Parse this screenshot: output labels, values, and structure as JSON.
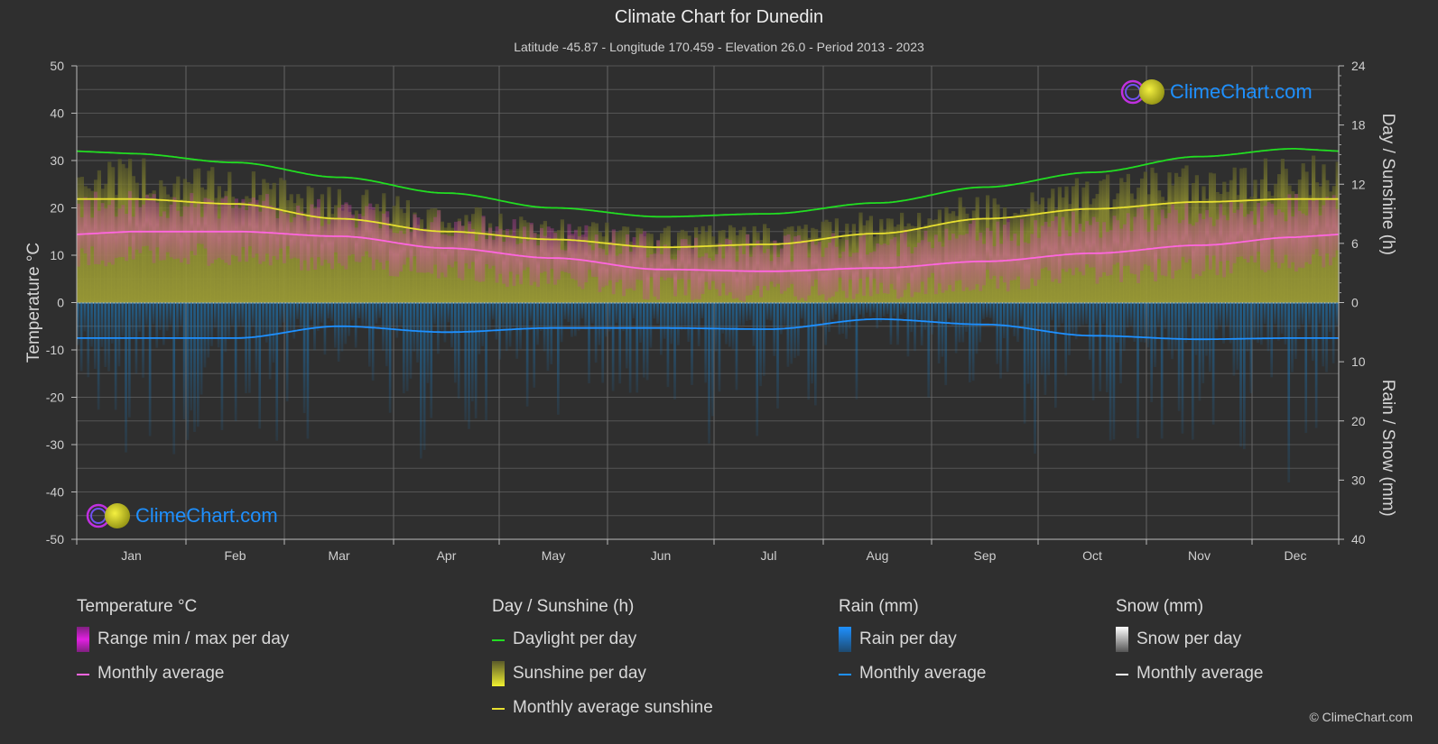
{
  "header": {
    "title": "Climate Chart for Dunedin",
    "subtitle": "Latitude -45.87 - Longitude 170.459 - Elevation 26.0 - Period 2013 - 2023"
  },
  "logo": {
    "text": "ClimeChart.com"
  },
  "copyright": "© ClimeChart.com",
  "colors": {
    "background": "#2f2f2f",
    "grid": "#5a5a5a",
    "temp_range": "#d040c0",
    "temp_avg": "#ff66e0",
    "daylight": "#22dd22",
    "sunshine_bar": "#9a9a30",
    "sunshine_avg": "#e8e030",
    "rain_bar": "#1e6ea8",
    "rain_avg": "#1e90ff",
    "snow_avg": "#ffffff",
    "logo_blue": "#1e90ff"
  },
  "legend": {
    "groups": [
      {
        "title": "Temperature °C",
        "items": [
          {
            "label": "Range min / max per day",
            "kind": "bar",
            "color": "#e020e0"
          },
          {
            "label": "Monthly average",
            "kind": "line",
            "color": "#ff66e0"
          }
        ]
      },
      {
        "title": "Day / Sunshine (h)",
        "items": [
          {
            "label": "Daylight per day",
            "kind": "line",
            "color": "#22dd22"
          },
          {
            "label": "Sunshine per day",
            "kind": "bar",
            "color": "#e8e030"
          },
          {
            "label": "Monthly average sunshine",
            "kind": "line",
            "color": "#e8e030"
          }
        ]
      },
      {
        "title": "Rain (mm)",
        "items": [
          {
            "label": "Rain per day",
            "kind": "bar",
            "color": "#1e90ff"
          },
          {
            "label": "Monthly average",
            "kind": "line",
            "color": "#1e90ff"
          }
        ]
      },
      {
        "title": "Snow (mm)",
        "items": [
          {
            "label": "Snow per day",
            "kind": "bar",
            "color": "#ffffff"
          },
          {
            "label": "Monthly average",
            "kind": "line",
            "color": "#ffffff"
          }
        ]
      }
    ]
  },
  "chart_data": {
    "type": "line",
    "title": "Climate Chart for Dunedin",
    "subtitle": "Latitude -45.87 - Longitude 170.459 - Elevation 26.0 - Period 2013 - 2023",
    "categories": [
      "Jan",
      "Feb",
      "Mar",
      "Apr",
      "May",
      "Jun",
      "Jul",
      "Aug",
      "Sep",
      "Oct",
      "Nov",
      "Dec"
    ],
    "axes": {
      "left": {
        "label": "Temperature °C",
        "range": [
          -50,
          50
        ],
        "ticks": [
          50,
          40,
          30,
          20,
          10,
          0,
          -10,
          -20,
          -30,
          -40,
          -50
        ]
      },
      "right_top": {
        "label": "Day / Sunshine (h)",
        "range": [
          0,
          24
        ],
        "ticks": [
          24,
          18,
          12,
          6,
          0
        ]
      },
      "right_bottom": {
        "label": "Rain / Snow (mm)",
        "range": [
          0,
          40
        ],
        "ticks": [
          10,
          20,
          30,
          40
        ]
      }
    },
    "grid": true,
    "series": [
      {
        "name": "Temperature monthly average",
        "unit": "°C",
        "axis": "left",
        "values": [
          15.0,
          15.0,
          14.0,
          11.5,
          9.4,
          7.0,
          6.6,
          7.3,
          8.7,
          10.4,
          12.1,
          13.8
        ]
      },
      {
        "name": "Temperature range max (approx.)",
        "unit": "°C",
        "axis": "left",
        "values": [
          21,
          20.5,
          19,
          16.5,
          14,
          12,
          11.5,
          12.5,
          14.5,
          16.5,
          18.5,
          20
        ]
      },
      {
        "name": "Temperature range min (approx.)",
        "unit": "°C",
        "axis": "left",
        "values": [
          10,
          10,
          9,
          7,
          5,
          3,
          2.5,
          3,
          4.5,
          6,
          7.5,
          9
        ]
      },
      {
        "name": "Daylight per day",
        "unit": "h",
        "axis": "right_top",
        "values": [
          15.1,
          14.2,
          12.7,
          11.1,
          9.6,
          8.7,
          9.0,
          10.1,
          11.7,
          13.2,
          14.8,
          15.6
        ]
      },
      {
        "name": "Sunshine per day (top of bars)",
        "unit": "h",
        "axis": "right_top",
        "values": [
          14.0,
          13.0,
          11.3,
          9.5,
          8.2,
          7.4,
          7.7,
          8.8,
          10.6,
          12.3,
          13.6,
          14.3
        ]
      },
      {
        "name": "Monthly average sunshine",
        "unit": "h",
        "axis": "right_top",
        "values": [
          10.5,
          10.0,
          8.5,
          7.2,
          6.4,
          5.6,
          5.9,
          7.0,
          8.5,
          9.5,
          10.2,
          10.5
        ]
      },
      {
        "name": "Rain monthly average",
        "unit": "mm",
        "axis": "right_bottom",
        "values": [
          6.0,
          6.0,
          4.0,
          5.0,
          4.3,
          4.3,
          4.5,
          2.8,
          3.7,
          5.6,
          6.2,
          6.0
        ]
      },
      {
        "name": "Snow monthly average",
        "unit": "mm",
        "axis": "right_bottom",
        "values": [
          0,
          0,
          0,
          0,
          0,
          0,
          0,
          0,
          0,
          0,
          0,
          0
        ]
      }
    ],
    "legend_position": "bottom"
  }
}
